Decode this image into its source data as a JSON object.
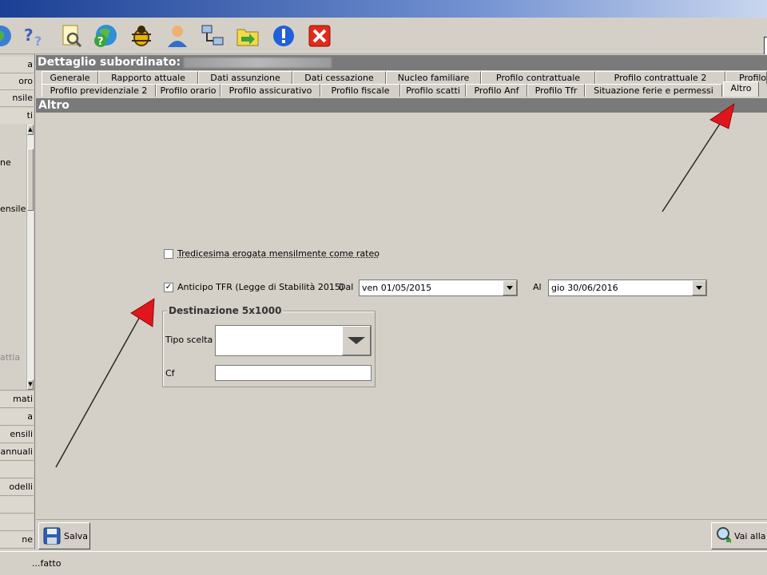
{
  "toolbar": {
    "icons": [
      "globe-icon",
      "help-icon",
      "search-document-icon",
      "question-globe-icon",
      "bug-icon",
      "user-icon",
      "network-icon",
      "folder-icon",
      "info-icon",
      "close-icon"
    ]
  },
  "sidebar": {
    "items_top": [
      "a",
      "oro",
      "nsile",
      "ti"
    ],
    "panel_items": [
      "ne",
      "ensile",
      "attia"
    ],
    "items_bottom": [
      "mati",
      "a",
      "ensili",
      "annuali",
      "",
      "odelli",
      "",
      "",
      "ne"
    ]
  },
  "header": {
    "title": "Dettaglio subordinato:"
  },
  "tabs": {
    "row1": [
      "Generale",
      "Rapporto attuale",
      "Dati assunzione",
      "Dati cessazione",
      "Nucleo familiare",
      "Profilo contrattuale",
      "Profilo contrattuale 2",
      "Profilo p"
    ],
    "row2": [
      "Profilo previdenziale 2",
      "Profilo orario",
      "Profilo assicurativo",
      "Profilo fiscale",
      "Profilo scatti",
      "Profilo Anf",
      "Profilo Tfr",
      "Situazione ferie e permessi",
      "Altro"
    ],
    "active": "Altro"
  },
  "section": {
    "title": "Altro"
  },
  "form": {
    "tredicesima": {
      "label": "Tredicesima erogata mensilmente come rateo",
      "checked": false
    },
    "anticipo_tfr": {
      "label": "Anticipo TFR (Legge di Stabilità 2015)",
      "checked": true
    },
    "dal_label": "Dal",
    "dal_value": "ven 01/05/2015",
    "al_label": "Al",
    "al_value": "gio 30/06/2016",
    "destinazione": {
      "legend": "Destinazione 5x1000",
      "tipo_scelta_label": "Tipo scelta",
      "tipo_scelta_value": "",
      "cf_label": "Cf",
      "cf_value": ""
    }
  },
  "buttons": {
    "salva": "Salva",
    "vai_alla": "Vai alla p"
  },
  "status": {
    "text": "...fatto"
  },
  "colors": {
    "background": "#d4d0c8",
    "header_bar": "#7a7a7a",
    "annotation_arrow": "#e0161c"
  }
}
